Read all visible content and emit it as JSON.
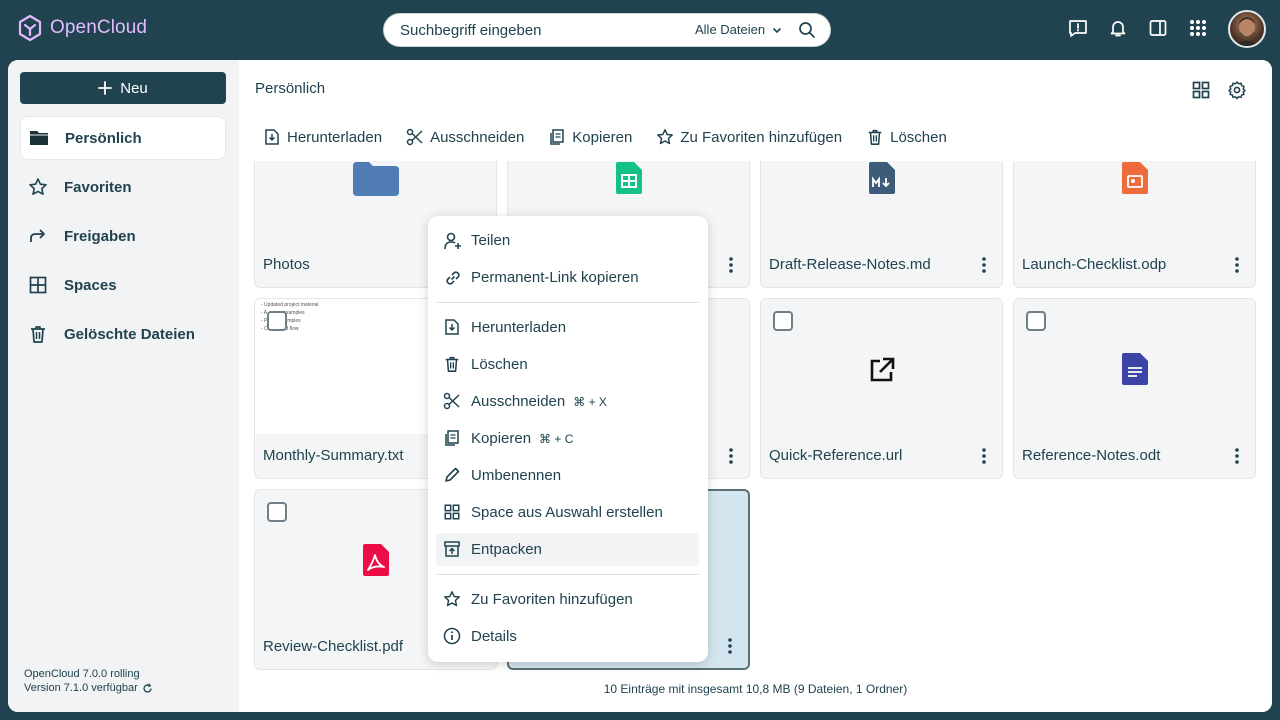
{
  "app": {
    "name": "OpenCloud"
  },
  "search": {
    "placeholder": "Suchbegriff eingeben",
    "scope": "Alle Dateien"
  },
  "sidebar": {
    "new_label": "Neu",
    "items": [
      {
        "label": "Persönlich",
        "icon": "folder-icon",
        "active": true
      },
      {
        "label": "Favoriten",
        "icon": "star-icon"
      },
      {
        "label": "Freigaben",
        "icon": "share-icon"
      },
      {
        "label": "Spaces",
        "icon": "grid-icon"
      },
      {
        "label": "Gelöschte Dateien",
        "icon": "trash-icon"
      }
    ],
    "version": "OpenCloud 7.0.0 rolling",
    "update": "Version 7.1.0 verfügbar"
  },
  "breadcrumb": "Persönlich",
  "actions": [
    "Herunterladen",
    "Ausschneiden",
    "Kopieren",
    "Zu Favoriten hinzufügen",
    "Löschen"
  ],
  "files": [
    {
      "name": "Photos",
      "type": "folder"
    },
    {
      "name": "",
      "type": "spreadsheet"
    },
    {
      "name": "Draft-Release-Notes.md",
      "type": "markdown"
    },
    {
      "name": "Launch-Checklist.odp",
      "type": "presentation"
    },
    {
      "name": "Monthly-Summary.txt",
      "type": "text",
      "preview_lines": [
        "- Updated project material",
        "- A... new examples",
        "- P... ng examples",
        "- C... upload flow"
      ]
    },
    {
      "name": "",
      "type": "hidden"
    },
    {
      "name": "Quick-Reference.url",
      "type": "link"
    },
    {
      "name": "Reference-Notes.odt",
      "type": "document"
    },
    {
      "name": "Review-Checklist.pdf",
      "type": "pdf"
    },
    {
      "name": "",
      "type": "selected"
    }
  ],
  "context_menu": {
    "items": [
      {
        "label": "Teilen",
        "icon": "user-plus-icon"
      },
      {
        "label": "Permanent-Link kopieren",
        "icon": "link-icon"
      },
      {
        "label": "Herunterladen",
        "icon": "download-icon"
      },
      {
        "label": "Löschen",
        "icon": "trash-icon"
      },
      {
        "label": "Ausschneiden",
        "icon": "scissors-icon",
        "shortcut": "⌘ + X"
      },
      {
        "label": "Kopieren",
        "icon": "copy-icon",
        "shortcut": "⌘ + C"
      },
      {
        "label": "Umbenennen",
        "icon": "pencil-icon"
      },
      {
        "label": "Space aus Auswahl erstellen",
        "icon": "grid-icon"
      },
      {
        "label": "Entpacken",
        "icon": "archive-icon",
        "hover": true
      },
      {
        "label": "Zu Favoriten hinzufügen",
        "icon": "star-icon"
      },
      {
        "label": "Details",
        "icon": "info-icon"
      }
    ]
  },
  "footer": "10 Einträge mit insgesamt 10,8 MB (9 Dateien, 1 Ordner)",
  "colors": {
    "brand": "#20434f",
    "logo": "#e2baff",
    "folder": "#4f7cb3",
    "spreadsheet": "#15c286",
    "markdown": "#3e5b79",
    "presentation": "#ee6b3b",
    "pdf": "#ec0d47",
    "document": "#3b44a6"
  }
}
